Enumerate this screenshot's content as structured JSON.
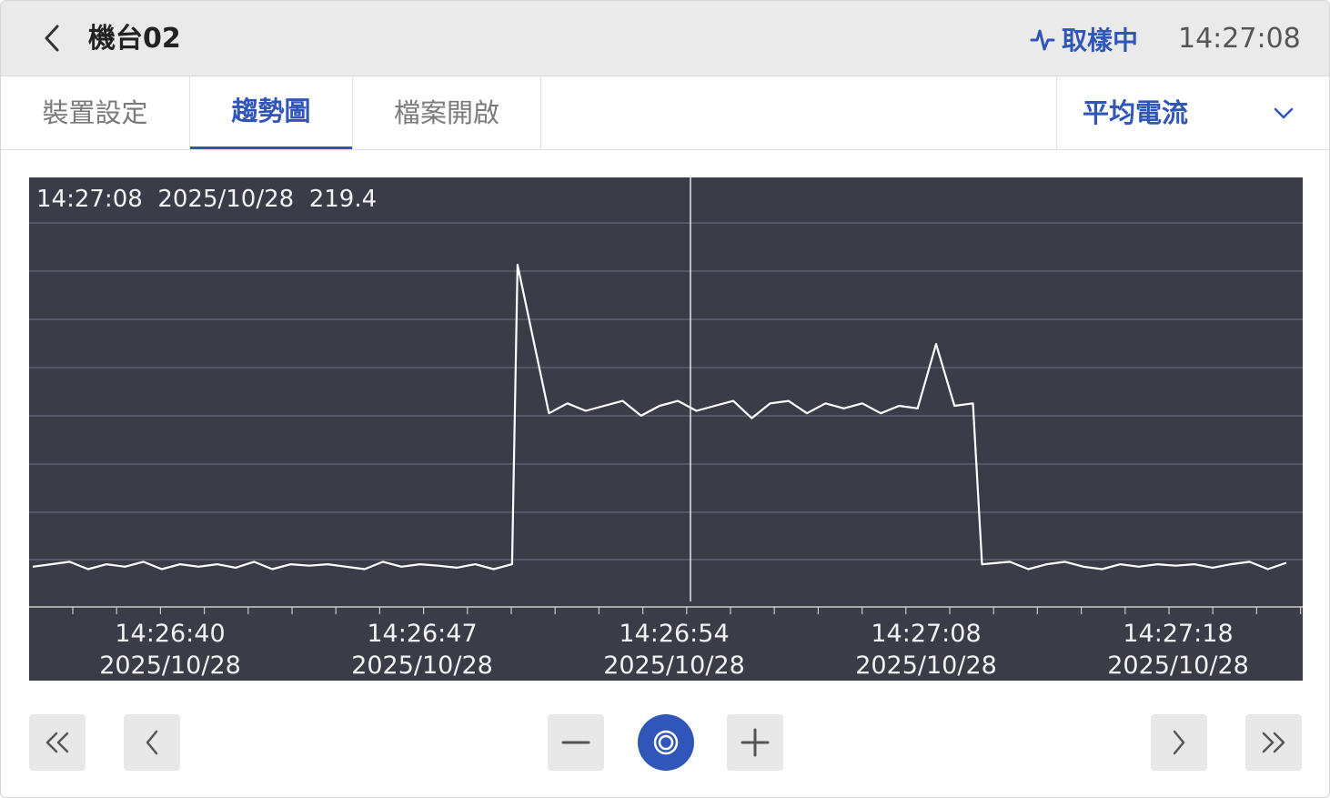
{
  "header": {
    "title": "機台02",
    "status_label": "取樣中",
    "time": "14:27:08",
    "accent_color": "#2f56b8"
  },
  "tabs": [
    {
      "label": "裝置設定",
      "active": false
    },
    {
      "label": "趨勢圖",
      "active": true
    },
    {
      "label": "檔案開啟",
      "active": false
    }
  ],
  "metric_select": {
    "selected": "平均電流"
  },
  "readout": {
    "time": "14:27:08",
    "date": "2025/10/28",
    "value": "219.4"
  },
  "chart_data": {
    "type": "line",
    "title": "",
    "xlabel": "",
    "ylabel": "",
    "grid": "horizontal",
    "background": "#3a3d47",
    "line_color": "#ffffff",
    "x_ticks": [
      {
        "time": "14:26:40",
        "date": "2025/10/28"
      },
      {
        "time": "14:26:47",
        "date": "2025/10/28"
      },
      {
        "time": "14:26:54",
        "date": "2025/10/28"
      },
      {
        "time": "14:27:08",
        "date": "2025/10/28"
      },
      {
        "time": "14:27:18",
        "date": "2025/10/28"
      }
    ],
    "cursor_index": 31,
    "ylim": [
      0,
      9
    ],
    "values": [
      0.5,
      0.55,
      0.6,
      0.45,
      0.55,
      0.5,
      0.6,
      0.45,
      0.55,
      0.5,
      0.55,
      0.48,
      0.6,
      0.45,
      0.55,
      0.52,
      0.55,
      0.5,
      0.45,
      0.6,
      0.5,
      0.55,
      0.52,
      0.48,
      0.55,
      0.45,
      0.55,
      6.6,
      3.6,
      3.8,
      3.65,
      3.75,
      3.85,
      3.55,
      3.75,
      3.85,
      3.65,
      3.75,
      3.85,
      3.5,
      3.8,
      3.85,
      3.6,
      3.8,
      3.7,
      3.8,
      3.6,
      3.75,
      3.7,
      5.0,
      3.75,
      3.8,
      0.55,
      0.6,
      0.45,
      0.55,
      0.6,
      0.5,
      0.45,
      0.55,
      0.5,
      0.55,
      0.52,
      0.55,
      0.48,
      0.55,
      0.6,
      0.45,
      0.58
    ]
  },
  "controls": {
    "first": "first-page",
    "prev": "previous",
    "zoom_out": "zoom-out",
    "reset": "reset-zoom",
    "zoom_in": "zoom-in",
    "next": "next",
    "last": "last-page"
  }
}
